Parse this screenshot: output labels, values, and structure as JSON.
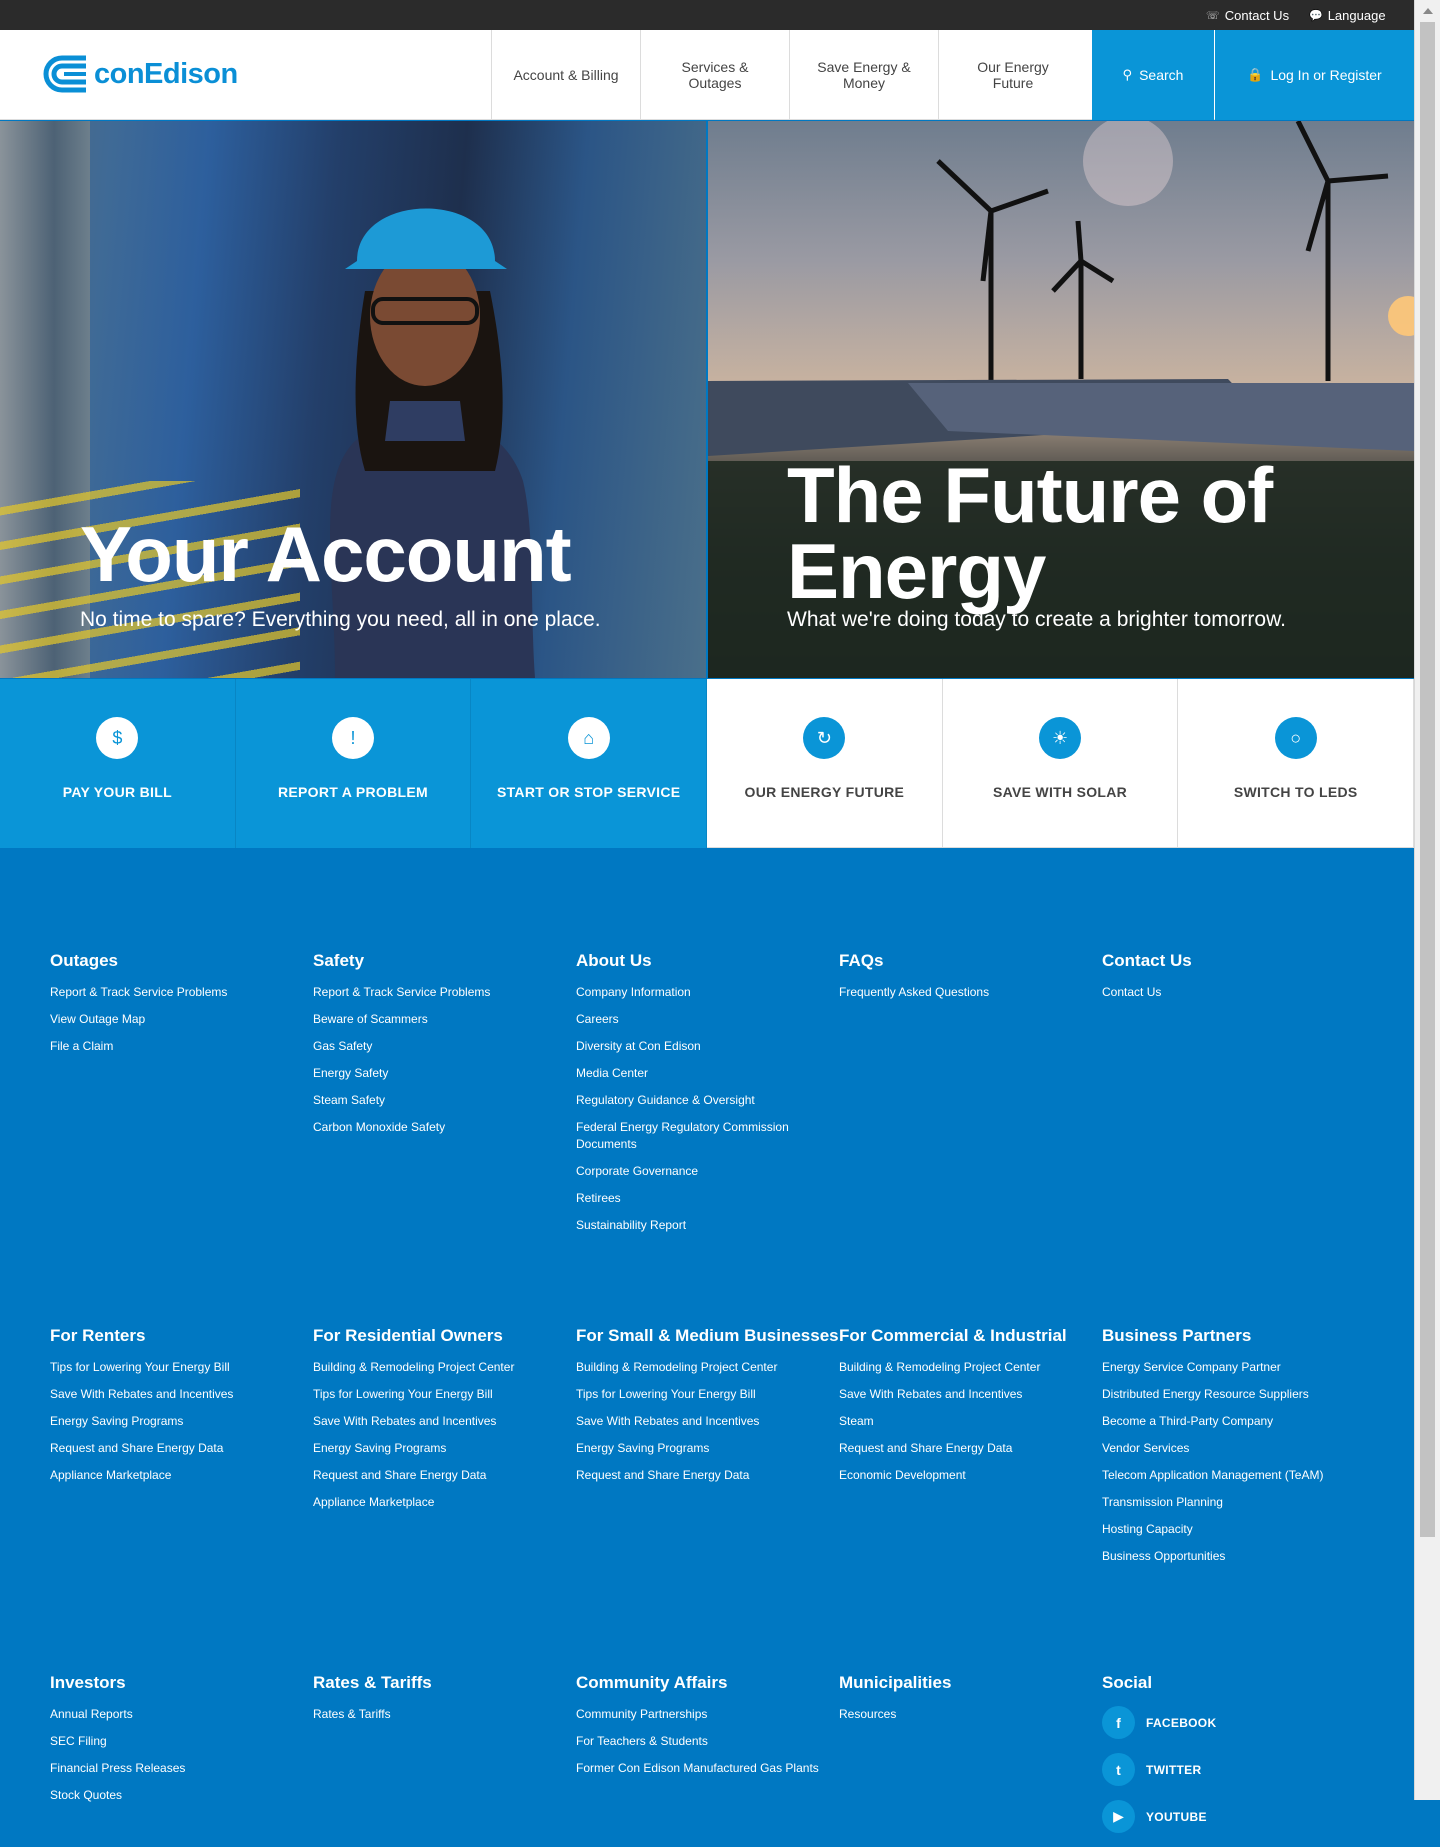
{
  "topbar": {
    "contact": "Contact Us",
    "language": "Language"
  },
  "brand": {
    "name": "conEdison",
    "color": "#0a8fd6"
  },
  "nav": {
    "items": [
      {
        "label": "Account & Billing"
      },
      {
        "label": "Services & Outages"
      },
      {
        "label": "Save Energy & Money"
      },
      {
        "label": "Our Energy Future"
      }
    ],
    "search": "Search",
    "login": "Log In or Register"
  },
  "hero": {
    "left": {
      "title": "Your Account",
      "subtitle": "No time to spare? Everything you need, all in one place."
    },
    "right": {
      "title_line1": "The Future of",
      "title_line2": "Energy",
      "subtitle": "What we're doing today to create a brighter tomorrow."
    }
  },
  "quick_links": [
    {
      "label": "PAY YOUR BILL",
      "icon": "bill-icon"
    },
    {
      "label": "REPORT A PROBLEM",
      "icon": "alert-icon"
    },
    {
      "label": "START OR STOP SERVICE",
      "icon": "building-icon"
    },
    {
      "label": "OUR ENERGY FUTURE",
      "icon": "refresh-energy-icon"
    },
    {
      "label": "SAVE WITH SOLAR",
      "icon": "sun-icon"
    },
    {
      "label": "SWITCH TO LEDS",
      "icon": "lightbulb-icon"
    }
  ],
  "footer": {
    "row1": [
      {
        "heading": "Outages",
        "links": [
          "Report & Track Service Problems",
          "View Outage Map",
          "File a Claim"
        ]
      },
      {
        "heading": "Safety",
        "links": [
          "Report & Track Service Problems",
          "Beware of Scammers",
          "Gas Safety",
          "Energy Safety",
          "Steam Safety",
          "Carbon Monoxide Safety"
        ]
      },
      {
        "heading": "About Us",
        "links": [
          "Company Information",
          "Careers",
          "Diversity at Con Edison",
          "Media Center",
          "Regulatory Guidance & Oversight",
          "Federal Energy Regulatory Commission Documents",
          "Corporate Governance",
          "Retirees",
          "Sustainability Report"
        ]
      },
      {
        "heading": "FAQs",
        "links": [
          "Frequently Asked Questions"
        ]
      },
      {
        "heading": "Contact Us",
        "links": [
          "Contact Us"
        ]
      }
    ],
    "row2": [
      {
        "heading": "For Renters",
        "links": [
          "Tips for Lowering Your Energy Bill",
          "Save With Rebates and Incentives",
          "Energy Saving Programs",
          "Request and Share Energy Data",
          "Appliance Marketplace"
        ]
      },
      {
        "heading": "For Residential Owners",
        "links": [
          "Building & Remodeling Project Center",
          "Tips for Lowering Your Energy Bill",
          "Save With Rebates and Incentives",
          "Energy Saving Programs",
          "Request and Share Energy Data",
          "Appliance Marketplace"
        ]
      },
      {
        "heading": "For Small & Medium Businesses",
        "links": [
          "Building & Remodeling Project Center",
          "Tips for Lowering Your Energy Bill",
          "Save With Rebates and Incentives",
          "Energy Saving Programs",
          "Request and Share Energy Data"
        ]
      },
      {
        "heading": "For Commercial & Industrial",
        "links": [
          "Building & Remodeling Project Center",
          "Save With Rebates and Incentives",
          "Steam",
          "Request and Share Energy Data",
          "Economic Development"
        ]
      },
      {
        "heading": "Business Partners",
        "links": [
          "Energy Service Company Partner",
          "Distributed Energy Resource Suppliers",
          "Become a Third-Party Company",
          "Vendor Services",
          "Telecom Application Management (TeAM)",
          "Transmission Planning",
          "Hosting Capacity",
          "Business Opportunities"
        ]
      }
    ],
    "row3": [
      {
        "heading": "Investors",
        "links": [
          "Annual Reports",
          "SEC Filing",
          "Financial Press Releases",
          "Stock Quotes"
        ]
      },
      {
        "heading": "Rates & Tariffs",
        "links": [
          "Rates & Tariffs"
        ]
      },
      {
        "heading": "Community Affairs",
        "links": [
          "Community Partnerships",
          "For Teachers & Students",
          "Former Con Edison Manufactured Gas Plants"
        ]
      },
      {
        "heading": "Municipalities",
        "links": [
          "Resources"
        ]
      }
    ],
    "social": {
      "heading": "Social",
      "items": [
        {
          "label": "FACEBOOK",
          "icon": "facebook-icon"
        },
        {
          "label": "TWITTER",
          "icon": "twitter-icon"
        },
        {
          "label": "YOUTUBE",
          "icon": "youtube-icon"
        }
      ]
    }
  },
  "colors": {
    "primary_blue": "#0a95d7",
    "footer_blue": "#0078c2",
    "topbar": "#2b2b2b"
  }
}
